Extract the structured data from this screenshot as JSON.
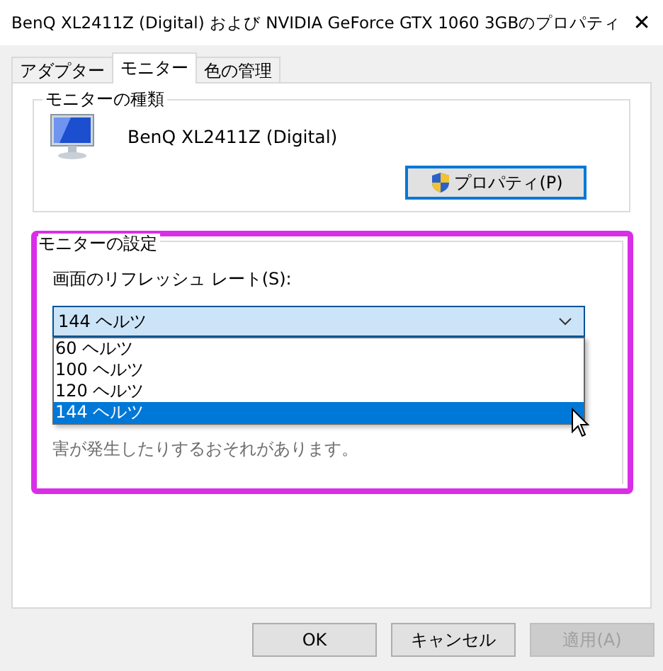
{
  "window": {
    "title": "BenQ XL2411Z (Digital) および NVIDIA GeForce GTX 1060 3GBのプロパティ",
    "close": "✕"
  },
  "tabs": [
    {
      "label": "アダプター",
      "selected": false
    },
    {
      "label": "モニター",
      "selected": true
    },
    {
      "label": "色の管理",
      "selected": false
    }
  ],
  "monitor_type": {
    "label": "モニターの種類",
    "monitor_name": "BenQ XL2411Z (Digital)",
    "properties_button": "プロパティ(P)"
  },
  "monitor_settings": {
    "label": "モニターの設定",
    "highlighted": true,
    "refresh_label": "画面のリフレッシュ レート(S):",
    "refresh_rate": {
      "value": "144 ヘルツ",
      "expanded": true,
      "options": [
        {
          "label": "60 ヘルツ",
          "selected": false
        },
        {
          "label": "100 ヘルツ",
          "selected": false
        },
        {
          "label": "120 ヘルツ",
          "selected": false
        },
        {
          "label": "144 ヘルツ",
          "selected": true
        }
      ]
    },
    "warning": "害が発生したりするおそれがあります。"
  },
  "buttons": [
    {
      "label": "OK",
      "disabled": false
    },
    {
      "label": "キャンセル",
      "disabled": false
    },
    {
      "label": "適用(A)",
      "disabled": true
    }
  ]
}
